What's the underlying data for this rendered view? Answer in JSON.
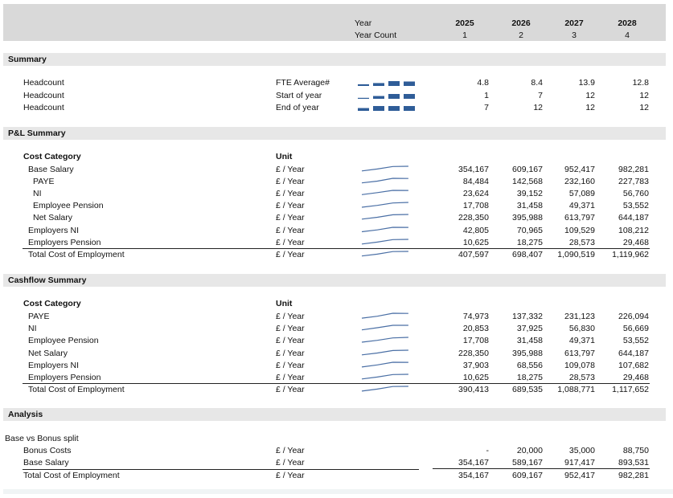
{
  "header": {
    "year_label": "Year",
    "year_count_label": "Year Count",
    "years": [
      "2025",
      "2026",
      "2027",
      "2028"
    ],
    "counts": [
      "1",
      "2",
      "3",
      "4"
    ]
  },
  "summary": {
    "title": "Summary",
    "rows": [
      {
        "label": "Headcount",
        "unit": "FTE Average#",
        "values": [
          "4.8",
          "8.4",
          "13.9",
          "12.8"
        ],
        "bars": [
          0.35,
          0.6,
          1.0,
          0.92
        ]
      },
      {
        "label": "Headcount",
        "unit": "Start of year",
        "values": [
          "1",
          "7",
          "12",
          "12"
        ],
        "bars": [
          0.08,
          0.58,
          1.0,
          1.0
        ]
      },
      {
        "label": "Headcount",
        "unit": "End of year",
        "values": [
          "7",
          "12",
          "12",
          "12"
        ],
        "bars": [
          0.58,
          1.0,
          1.0,
          1.0
        ]
      }
    ]
  },
  "pl": {
    "title": "P&L Summary",
    "cat_header": "Cost Category",
    "unit_header": "Unit",
    "rows": [
      {
        "label": "Base Salary",
        "unit": "£ / Year",
        "values": [
          "354,167",
          "609,167",
          "952,417",
          "982,281"
        ],
        "raw": [
          354167,
          609167,
          952417,
          982281
        ]
      },
      {
        "label": "PAYE",
        "unit": "£ / Year",
        "values": [
          "84,484",
          "142,568",
          "232,160",
          "227,783"
        ],
        "raw": [
          84484,
          142568,
          232160,
          227783
        ]
      },
      {
        "label": "NI",
        "unit": "£ / Year",
        "values": [
          "23,624",
          "39,152",
          "57,089",
          "56,760"
        ],
        "raw": [
          23624,
          39152,
          57089,
          56760
        ]
      },
      {
        "label": "Employee Pension",
        "unit": "£ / Year",
        "values": [
          "17,708",
          "31,458",
          "49,371",
          "53,552"
        ],
        "raw": [
          17708,
          31458,
          49371,
          53552
        ]
      },
      {
        "label": "Net Salary",
        "unit": "£ / Year",
        "values": [
          "228,350",
          "395,988",
          "613,797",
          "644,187"
        ],
        "raw": [
          228350,
          395988,
          613797,
          644187
        ]
      },
      {
        "label": "Employers NI",
        "unit": "£ / Year",
        "values": [
          "42,805",
          "70,965",
          "109,529",
          "108,212"
        ],
        "raw": [
          42805,
          70965,
          109529,
          108212
        ]
      },
      {
        "label": "Employers Pension",
        "unit": "£ / Year",
        "values": [
          "10,625",
          "18,275",
          "28,573",
          "29,468"
        ],
        "raw": [
          10625,
          18275,
          28573,
          29468
        ]
      },
      {
        "label": "Total Cost of Employment",
        "unit": "£ / Year",
        "values": [
          "407,597",
          "698,407",
          "1,090,519",
          "1,119,962"
        ],
        "raw": [
          407597,
          698407,
          1090519,
          1119962
        ]
      }
    ]
  },
  "cashflow": {
    "title": "Cashflow Summary",
    "cat_header": "Cost Category",
    "unit_header": "Unit",
    "rows": [
      {
        "label": "PAYE",
        "unit": "£ / Year",
        "values": [
          "74,973",
          "137,332",
          "231,123",
          "226,094"
        ],
        "raw": [
          74973,
          137332,
          231123,
          226094
        ]
      },
      {
        "label": "NI",
        "unit": "£ / Year",
        "values": [
          "20,853",
          "37,925",
          "56,830",
          "56,669"
        ],
        "raw": [
          20853,
          37925,
          56830,
          56669
        ]
      },
      {
        "label": "Employee Pension",
        "unit": "£ / Year",
        "values": [
          "17,708",
          "31,458",
          "49,371",
          "53,552"
        ],
        "raw": [
          17708,
          31458,
          49371,
          53552
        ]
      },
      {
        "label": "Net Salary",
        "unit": "£ / Year",
        "values": [
          "228,350",
          "395,988",
          "613,797",
          "644,187"
        ],
        "raw": [
          228350,
          395988,
          613797,
          644187
        ]
      },
      {
        "label": "Employers NI",
        "unit": "£ / Year",
        "values": [
          "37,903",
          "68,556",
          "109,078",
          "107,682"
        ],
        "raw": [
          37903,
          68556,
          109078,
          107682
        ]
      },
      {
        "label": "Employers Pension",
        "unit": "£ / Year",
        "values": [
          "10,625",
          "18,275",
          "28,573",
          "29,468"
        ],
        "raw": [
          10625,
          18275,
          28573,
          29468
        ]
      },
      {
        "label": "Total Cost of Employment",
        "unit": "£ / Year",
        "values": [
          "390,413",
          "689,535",
          "1,088,771",
          "1,117,652"
        ],
        "raw": [
          390413,
          689535,
          1088771,
          1117652
        ]
      }
    ]
  },
  "analysis": {
    "title": "Analysis",
    "subhead": "Base vs Bonus split",
    "rows": [
      {
        "label": "Bonus Costs",
        "unit": "£ / Year",
        "values": [
          "-",
          "20,000",
          "35,000",
          "88,750"
        ]
      },
      {
        "label": "Base Salary",
        "unit": "£ / Year",
        "values": [
          "354,167",
          "589,167",
          "917,417",
          "893,531"
        ]
      },
      {
        "label": "Total Cost of Employment",
        "unit": "£ / Year",
        "values": [
          "354,167",
          "609,167",
          "952,417",
          "982,281"
        ]
      }
    ]
  },
  "colors": {
    "spark": "#4a6fa5",
    "bar": "#2f5d98",
    "header_band": "#d9d9d9",
    "section_band": "#e7e7e7"
  }
}
